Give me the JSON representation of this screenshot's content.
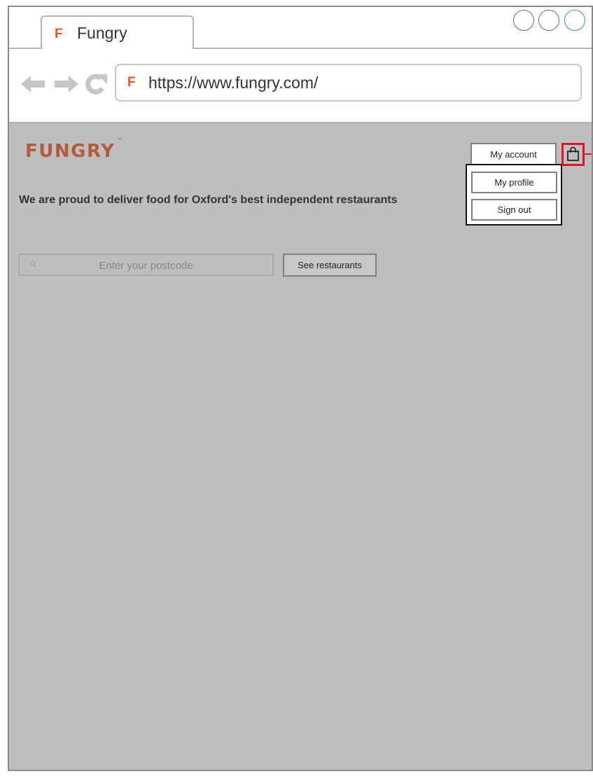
{
  "browser": {
    "tab": {
      "icon_letter": "F",
      "title": "Fungry"
    },
    "address": {
      "icon_letter": "F",
      "url": "https://www.fungry.com/"
    },
    "window_buttons": [
      "circle",
      "circle",
      "circle-active"
    ],
    "nav_icons": [
      "back-arrow-icon",
      "forward-arrow-icon",
      "refresh-icon"
    ]
  },
  "page": {
    "logo": "FUNGRY",
    "logo_tm": "™",
    "tagline": "We are proud to deliver food for Oxford's best independent restaurants",
    "search": {
      "placeholder": "Enter your postcode",
      "icon": "search-icon"
    },
    "see_button": "See restaurants",
    "account_button": "My account",
    "cart_icon": "shopping-bag-icon",
    "dropdown": {
      "items": [
        "My profile",
        "Sign out"
      ]
    }
  },
  "colors": {
    "brand": "#e95420",
    "logo": "#b25a3c",
    "content_bg": "#bebebe",
    "highlight": "#e0161f",
    "active_window_button": "#2a8ff0"
  }
}
